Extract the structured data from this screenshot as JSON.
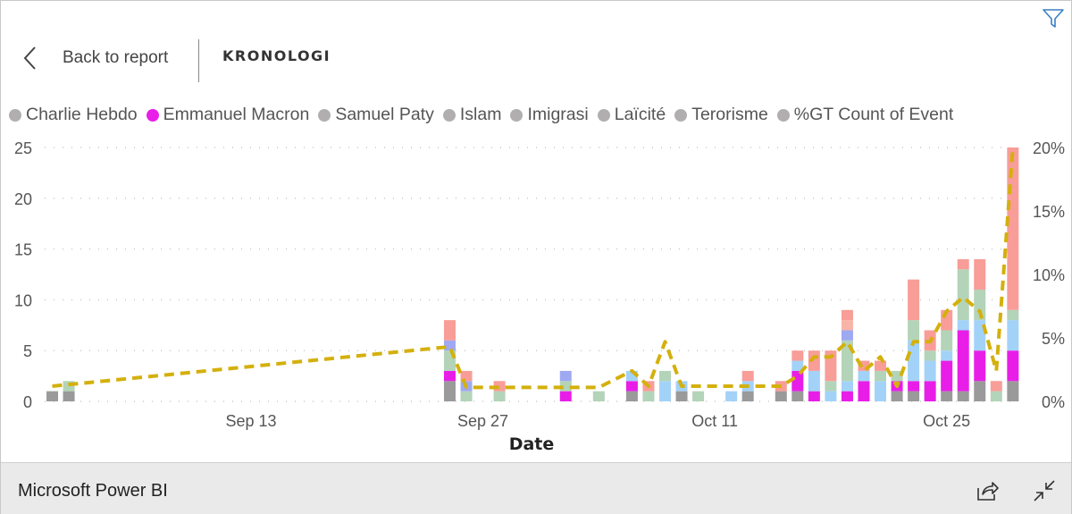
{
  "header": {
    "back_label": "Back to report",
    "title": "KRONOLOGI",
    "filter_icon": "filter-icon",
    "back_icon": "chevron-left-icon"
  },
  "footer": {
    "brand": "Microsoft Power BI",
    "share_icon": "share-icon",
    "collapse_icon": "collapse-icon"
  },
  "chart_data": {
    "type": "bar",
    "stacked": true,
    "xlabel": "Date",
    "ylabel": "",
    "ylim": [
      0,
      25
    ],
    "y2lim": [
      0,
      20
    ],
    "yticks": [
      "0",
      "5",
      "10",
      "15",
      "20",
      "25"
    ],
    "y2ticks": [
      "0%",
      "5%",
      "10%",
      "15%",
      "20%"
    ],
    "xticks": [
      "Sep 13",
      "Sep 27",
      "Oct 11",
      "Oct 25"
    ],
    "grid": true,
    "legend_position": "top",
    "series": [
      {
        "name": "Charlie Hebdo",
        "color": "#9a9a9a",
        "legend_color": "#b0aeae"
      },
      {
        "name": "Emmanuel Macron",
        "color": "#e81ee8",
        "legend_color": "#e81ee8"
      },
      {
        "name": "Samuel Paty",
        "color": "#a3d2f8",
        "legend_color": "#b0aeae"
      },
      {
        "name": "Islam",
        "color": "#b3d4b8",
        "legend_color": "#b0aeae"
      },
      {
        "name": "Imigrasi",
        "color": "#9ea9f2",
        "legend_color": "#b0aeae"
      },
      {
        "name": "Laïcité",
        "color": "#f9b4a8",
        "legend_color": "#b0aeae"
      },
      {
        "name": "Terorisme",
        "color": "#f89d98",
        "legend_color": "#b0aeae"
      }
    ],
    "line": {
      "name": "%GT Count of Event",
      "color": "#d4b00c",
      "legend_color": "#b0aeae",
      "axis": "right"
    },
    "bars": [
      {
        "date": "Sep 1",
        "values": [
          1,
          0,
          0,
          0,
          0,
          0,
          0
        ]
      },
      {
        "date": "Sep 2",
        "values": [
          1,
          0,
          0,
          1,
          0,
          0,
          0
        ]
      },
      {
        "date": "Sep 25",
        "values": [
          2,
          1,
          0,
          2,
          1,
          0,
          2
        ]
      },
      {
        "date": "Sep 26",
        "values": [
          0,
          0,
          0,
          1,
          1,
          0,
          1
        ]
      },
      {
        "date": "Sep 28",
        "values": [
          0,
          0,
          0,
          1,
          0,
          0,
          1
        ]
      },
      {
        "date": "Oct 2",
        "values": [
          0,
          1,
          0,
          1,
          1,
          0,
          0
        ]
      },
      {
        "date": "Oct 4",
        "values": [
          0,
          0,
          0,
          1,
          0,
          0,
          0
        ]
      },
      {
        "date": "Oct 6",
        "values": [
          1,
          1,
          1,
          0,
          0,
          0,
          0
        ]
      },
      {
        "date": "Oct 7",
        "values": [
          0,
          0,
          0,
          1,
          0,
          0,
          1
        ]
      },
      {
        "date": "Oct 8",
        "values": [
          0,
          0,
          2,
          1,
          0,
          0,
          0
        ]
      },
      {
        "date": "Oct 9",
        "values": [
          1,
          0,
          1,
          0,
          0,
          0,
          0
        ]
      },
      {
        "date": "Oct 10",
        "values": [
          0,
          0,
          0,
          1,
          0,
          0,
          0
        ]
      },
      {
        "date": "Oct 12",
        "values": [
          0,
          0,
          1,
          0,
          0,
          0,
          0
        ]
      },
      {
        "date": "Oct 13",
        "values": [
          1,
          0,
          1,
          0,
          0,
          0,
          1
        ]
      },
      {
        "date": "Oct 15",
        "values": [
          1,
          0,
          0,
          0,
          0,
          0,
          1
        ]
      },
      {
        "date": "Oct 16",
        "values": [
          1,
          2,
          1,
          0,
          0,
          0,
          1
        ]
      },
      {
        "date": "Oct 17",
        "values": [
          0,
          1,
          2,
          0,
          0,
          0,
          2
        ]
      },
      {
        "date": "Oct 18",
        "values": [
          0,
          0,
          1,
          1,
          0,
          0,
          3
        ]
      },
      {
        "date": "Oct 19",
        "values": [
          0,
          1,
          1,
          4,
          1,
          1,
          1
        ]
      },
      {
        "date": "Oct 20",
        "values": [
          0,
          2,
          1,
          0,
          0,
          0,
          1
        ]
      },
      {
        "date": "Oct 21",
        "values": [
          0,
          0,
          2,
          1,
          0,
          0,
          1
        ]
      },
      {
        "date": "Oct 22",
        "values": [
          1,
          1,
          0,
          1,
          0,
          0,
          0
        ]
      },
      {
        "date": "Oct 23",
        "values": [
          1,
          1,
          4,
          2,
          0,
          0,
          4
        ]
      },
      {
        "date": "Oct 24",
        "values": [
          0,
          2,
          2,
          1,
          0,
          0,
          2
        ]
      },
      {
        "date": "Oct 25",
        "values": [
          1,
          3,
          1,
          2,
          0,
          0,
          2
        ]
      },
      {
        "date": "Oct 26",
        "values": [
          1,
          6,
          1,
          5,
          0,
          0,
          1
        ]
      },
      {
        "date": "Oct 27",
        "values": [
          2,
          3,
          3,
          3,
          0,
          0,
          3
        ]
      },
      {
        "date": "Oct 28",
        "values": [
          0,
          0,
          0,
          1,
          0,
          0,
          1
        ]
      },
      {
        "date": "Oct 29",
        "values": [
          2,
          3,
          3,
          1,
          0,
          0,
          16
        ]
      }
    ],
    "line_values": [
      {
        "date": "Sep 1",
        "value": 1.2
      },
      {
        "date": "Sep 25",
        "value": 4.3
      },
      {
        "date": "Sep 26",
        "value": 1.1
      },
      {
        "date": "Sep 28",
        "value": 1.1
      },
      {
        "date": "Oct 2",
        "value": 1.1
      },
      {
        "date": "Oct 4",
        "value": 1.1
      },
      {
        "date": "Oct 6",
        "value": 2.4
      },
      {
        "date": "Oct 7",
        "value": 1.2
      },
      {
        "date": "Oct 8",
        "value": 4.7
      },
      {
        "date": "Oct 9",
        "value": 1.2
      },
      {
        "date": "Oct 10",
        "value": 1.2
      },
      {
        "date": "Oct 12",
        "value": 1.2
      },
      {
        "date": "Oct 13",
        "value": 1.2
      },
      {
        "date": "Oct 15",
        "value": 1.2
      },
      {
        "date": "Oct 16",
        "value": 2.0
      },
      {
        "date": "Oct 17",
        "value": 3.5
      },
      {
        "date": "Oct 18",
        "value": 3.5
      },
      {
        "date": "Oct 19",
        "value": 4.7
      },
      {
        "date": "Oct 20",
        "value": 2.4
      },
      {
        "date": "Oct 21",
        "value": 3.5
      },
      {
        "date": "Oct 22",
        "value": 1.2
      },
      {
        "date": "Oct 23",
        "value": 4.7
      },
      {
        "date": "Oct 24",
        "value": 4.7
      },
      {
        "date": "Oct 25",
        "value": 7.1
      },
      {
        "date": "Oct 26",
        "value": 8.2
      },
      {
        "date": "Oct 27",
        "value": 7.1
      },
      {
        "date": "Oct 28",
        "value": 2.4
      },
      {
        "date": "Oct 29",
        "value": 20
      }
    ]
  }
}
